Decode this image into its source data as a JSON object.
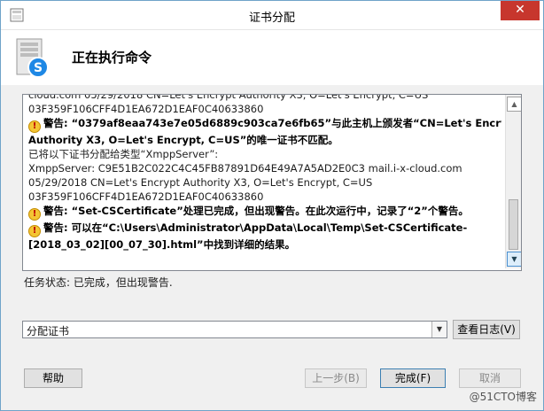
{
  "window": {
    "title": "证书分配",
    "close_symbol": "✕"
  },
  "header": {
    "title": "正在执行命令"
  },
  "log": {
    "lines": [
      {
        "text": "cloud.com 05/29/2018 CN=Let's Encrypt Authority X3, O=Let's Encrypt, C=US",
        "warn": false
      },
      {
        "text": "03F359F106CFF4D1EA672D1EAF0C40633860",
        "warn": false
      },
      {
        "text": "警告: “0379af8eaa743e7e05d6889c903ca7e6fb65”与此主机上颁发者“CN=Let's Encrypt",
        "warn": true,
        "icon": true
      },
      {
        "text": "Authority X3, O=Let's Encrypt, C=US”的唯一证书不匹配。",
        "warn": true
      },
      {
        "text": "已将以下证书分配给类型“XmppServer”:",
        "warn": false
      },
      {
        "text": "XmppServer: C9E51B2C022C4C45FB87891D64E49A7A5AD2E0C3 mail.i-x-cloud.com",
        "warn": false
      },
      {
        "text": "05/29/2018 CN=Let's Encrypt Authority X3, O=Let's Encrypt, C=US",
        "warn": false
      },
      {
        "text": "03F359F106CFF4D1EA672D1EAF0C40633860",
        "warn": false
      },
      {
        "text": "警告: “Set-CSCertificate”处理已完成，但出现警告。在此次运行中，记录了“2”个警告。",
        "warn": true,
        "icon": true
      },
      {
        "text": "警告: 可以在“C:\\Users\\Administrator\\AppData\\Local\\Temp\\Set-CSCertificate-",
        "warn": true,
        "icon": true
      },
      {
        "text": "[2018_03_02][00_07_30].html”中找到详细的结果。",
        "warn": true
      }
    ]
  },
  "status": {
    "text": "任务状态: 已完成，但出现警告."
  },
  "action_combo": {
    "value": "分配证书"
  },
  "buttons": {
    "view_log": "查看日志(V)",
    "help": "帮助",
    "back": "上一步(B)",
    "finish": "完成(F)",
    "cancel": "取消"
  },
  "watermark": "@51CTO博客",
  "colors": {
    "close_button": "#c7362d",
    "warning_icon": "#f4c534",
    "border": "#6fa3c9"
  }
}
